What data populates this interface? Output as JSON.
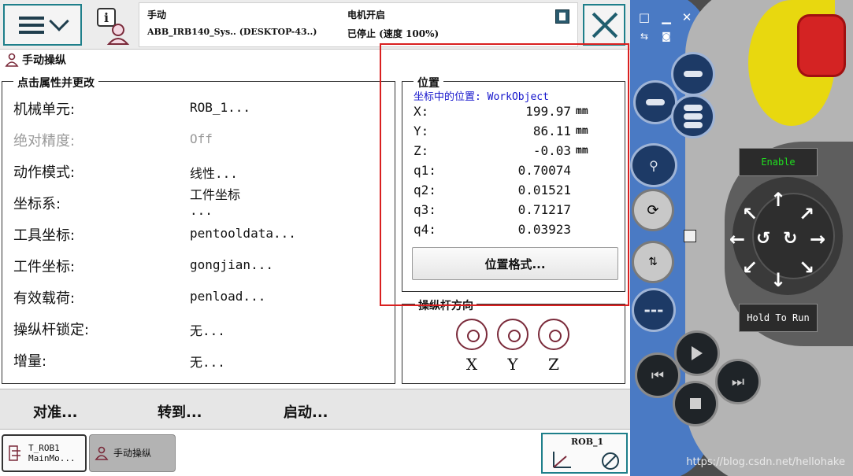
{
  "header": {
    "mode": "手动",
    "system": "ABB_IRB140_Sys.. (DESKTOP-43..)",
    "motor_state": "电机开启",
    "speed_state": "已停止 (速度 100%)"
  },
  "page": {
    "title": "手动操纵"
  },
  "properties": {
    "legend": "点击属性并更改",
    "rows": [
      {
        "label": "机械单元:",
        "value": "ROB_1..."
      },
      {
        "label": "绝对精度:",
        "value": "Off"
      },
      {
        "label": "动作模式:",
        "value": "线性..."
      },
      {
        "label": "坐标系:",
        "value": "工件坐标",
        "value2": "..."
      },
      {
        "label": "工具坐标:",
        "value": "pentooldata..."
      },
      {
        "label": "工件坐标:",
        "value": "gongjian..."
      },
      {
        "label": "有效载荷:",
        "value": "penload..."
      },
      {
        "label": "操纵杆锁定:",
        "value": "无..."
      },
      {
        "label": "增量:",
        "value": "无..."
      }
    ]
  },
  "position": {
    "legend": "位置",
    "caption": "坐标中的位置: WorkObject",
    "rows": [
      {
        "name": "X:",
        "value": "199.97",
        "unit": "mm"
      },
      {
        "name": "Y:",
        "value": "86.11",
        "unit": "mm"
      },
      {
        "name": "Z:",
        "value": "-0.03",
        "unit": "mm"
      },
      {
        "name": "q1:",
        "value": "0.70074",
        "unit": ""
      },
      {
        "name": "q2:",
        "value": "0.01521",
        "unit": ""
      },
      {
        "name": "q3:",
        "value": "0.71217",
        "unit": ""
      },
      {
        "name": "q4:",
        "value": "0.03923",
        "unit": ""
      }
    ],
    "format_button": "位置格式..."
  },
  "joystick": {
    "legend": "操纵杆方向",
    "axes": [
      "X",
      "Y",
      "Z"
    ]
  },
  "commands": {
    "align": "对准...",
    "goto": "转到...",
    "start": "启动..."
  },
  "taskbar": {
    "task1_line1": "T_ROB1",
    "task1_line2": "MainMo...",
    "task2": "手动操纵",
    "quickset_label": "ROB_1"
  },
  "device": {
    "enable": "Enable",
    "hold_to_run": "Hold To Run"
  },
  "watermark": "https://blog.csdn.net/hellohake",
  "colors": {
    "accent_border": "#1e7f8a",
    "caption_blue": "#1515cc",
    "highlight_red": "#d92020",
    "enable_green": "#1fe01f",
    "pendant_blue": "#4a7ac4",
    "estop_red": "#d42323",
    "knob_yellow": "#e8d80f"
  }
}
